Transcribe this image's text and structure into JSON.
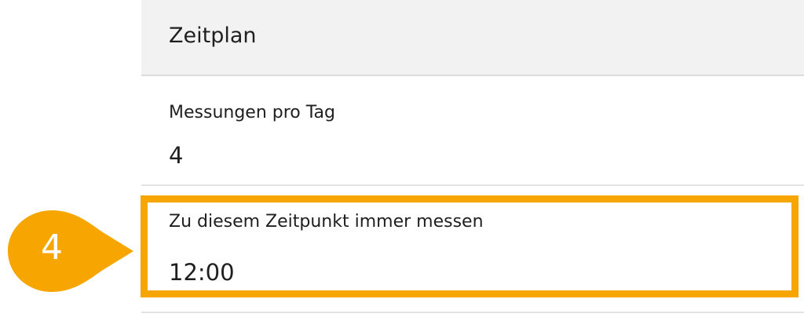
{
  "section": {
    "title": "Zeitplan"
  },
  "rows": [
    {
      "label": "Messungen pro Tag",
      "value": "4"
    },
    {
      "label": "Zu diesem Zeitpunkt immer messen",
      "value": "12:00"
    }
  ],
  "callout": {
    "number": "4"
  },
  "colors": {
    "header_bg": "#f2f2f2",
    "highlight": "#f7a500",
    "callout": "#f7a500",
    "text": "#1f1f1f"
  }
}
